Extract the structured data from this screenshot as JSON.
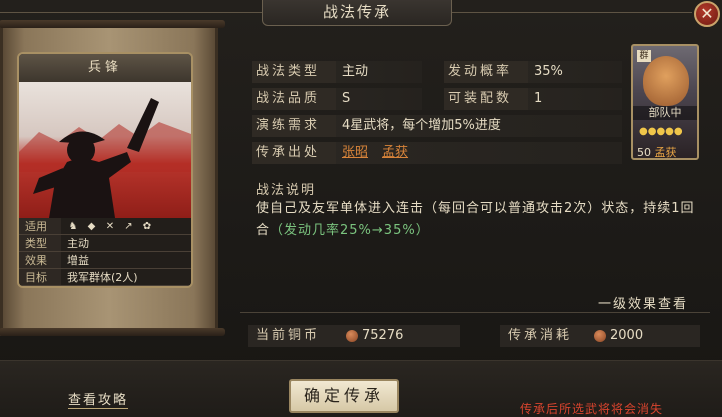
{
  "title": "战法传承",
  "close_symbol": "✕",
  "skill_card": {
    "name": "兵锋",
    "rows": [
      {
        "key": "适用",
        "value": ""
      },
      {
        "key": "类型",
        "value": "主动"
      },
      {
        "key": "效果",
        "value": "增益"
      },
      {
        "key": "目标",
        "value": "我军群体(2人)"
      }
    ],
    "troop_icons": [
      "cavalry-icon",
      "shield-icon",
      "archer-icon",
      "spear-icon",
      "siege-icon"
    ]
  },
  "fields": {
    "type": {
      "label": "战法类型",
      "value": "主动"
    },
    "quality": {
      "label": "战法品质",
      "value": "S"
    },
    "requirement": {
      "label": "演练需求",
      "value": "4星武将，每个增加5%进度"
    },
    "source": {
      "label": "传承出处",
      "generals": [
        "张昭",
        "孟获"
      ]
    },
    "trigger_rate": {
      "label": "发动概率",
      "value": "35%"
    },
    "equip_count": {
      "label": "可装配数",
      "value": "1"
    }
  },
  "description": {
    "heading": "战法说明",
    "text": "使自己及友军单体进入连击（每回合可以普通攻击2次）状态，持续1回合",
    "upgrade_text": "（发动几率25%→35%）"
  },
  "effect_link": "一级效果查看",
  "portrait": {
    "badge": "群",
    "troop_label": "部队中",
    "stars": "●●●●●",
    "level": "50",
    "general_name": "孟获"
  },
  "currency": {
    "current_label": "当前铜币",
    "current_value": "75276",
    "cost_label": "传承消耗",
    "cost_value": "2000"
  },
  "guide_link": "查看攻略",
  "confirm_button": "确定传承",
  "warning": "传承后所选武将将会消失",
  "colors": {
    "accent_orange": "#d8843a",
    "warning_red": "#d8442e",
    "upgrade_green": "#7bc47f"
  }
}
